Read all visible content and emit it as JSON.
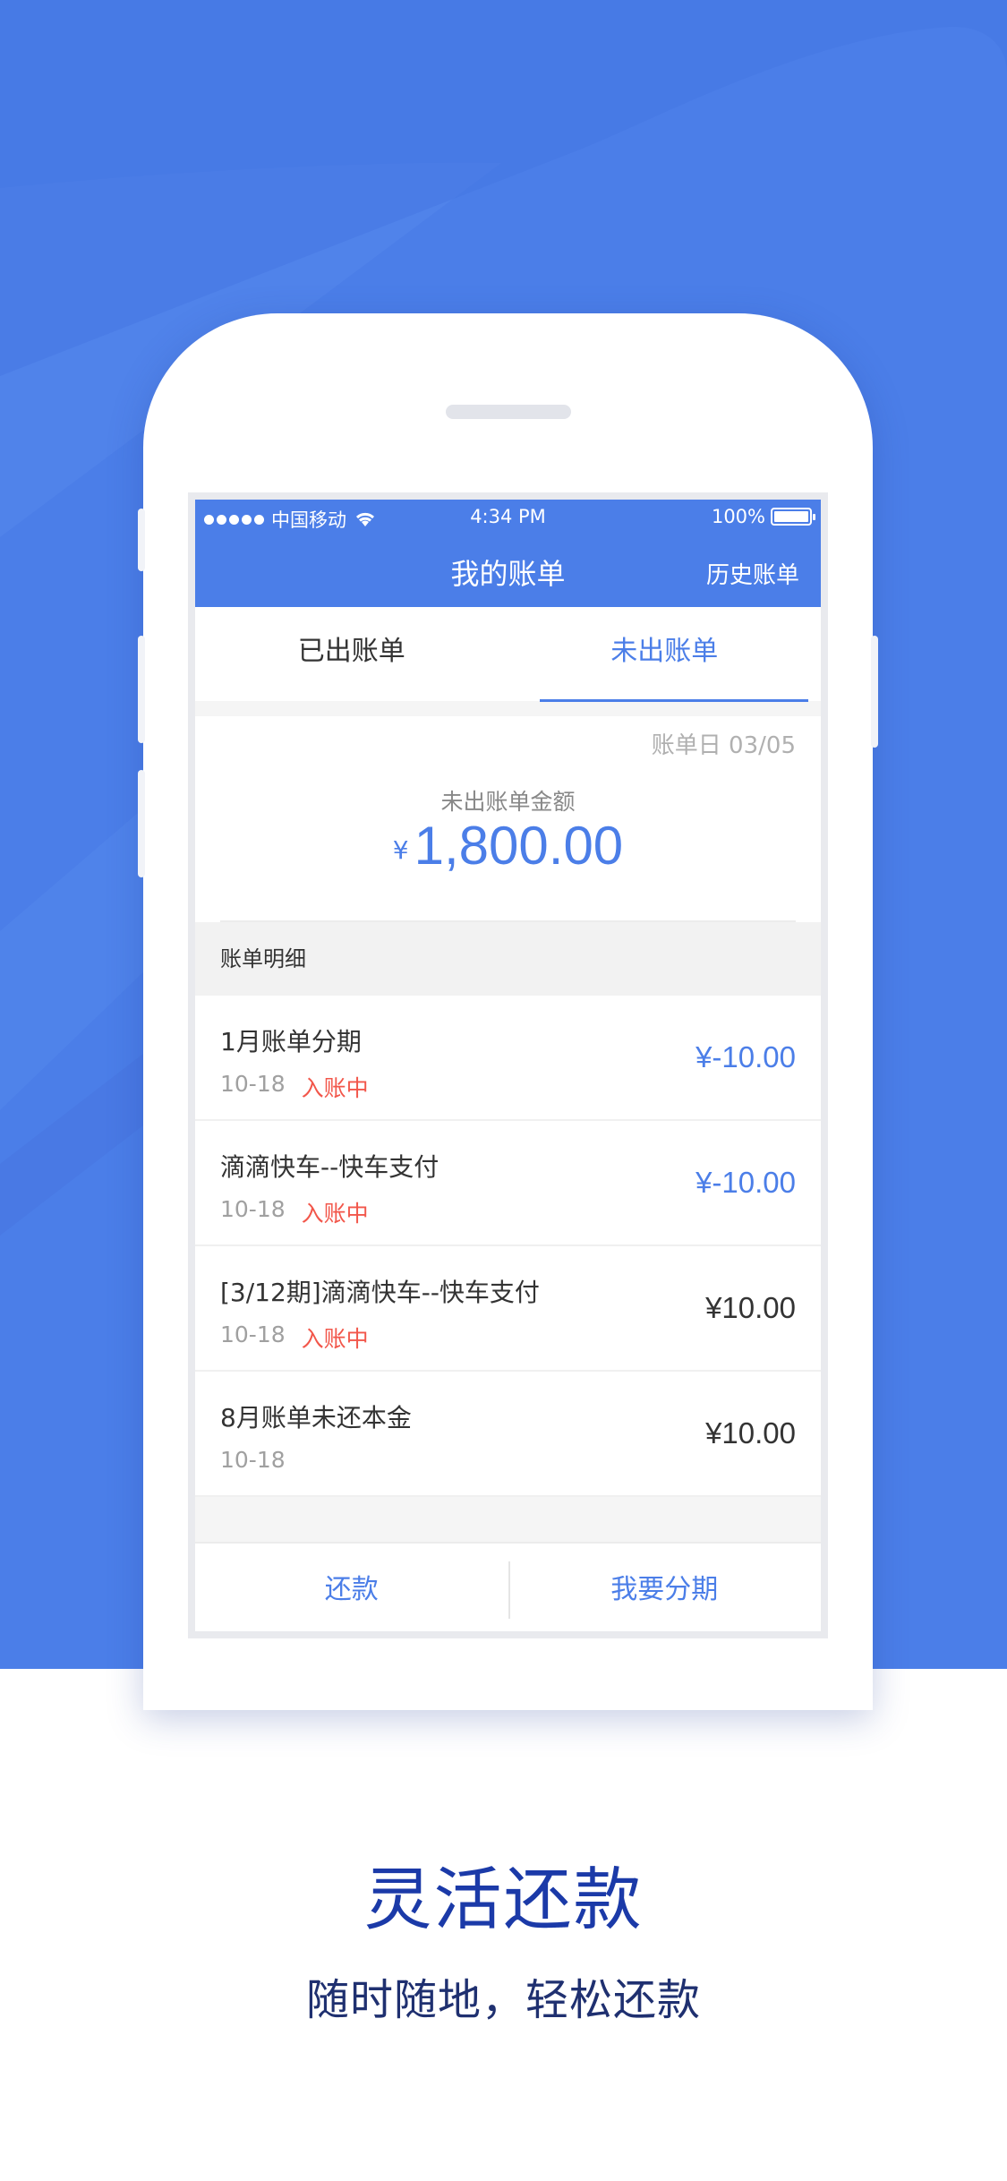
{
  "colors": {
    "brand_blue": "#4b7ee8",
    "status_red": "#f2574b",
    "caption_blue": "#1b3aa8",
    "caption_navy": "#1f3070"
  },
  "status_bar": {
    "carrier": "中国移动",
    "time": "4:34 PM",
    "battery": "100%",
    "wifi_icon": "wifi-icon",
    "battery_icon": "battery-icon"
  },
  "navbar": {
    "title": "我的账单",
    "history_label": "历史账单"
  },
  "tabs": [
    {
      "label": "已出账单",
      "selected": false
    },
    {
      "label": "未出账单",
      "selected": true
    }
  ],
  "summary": {
    "bill_date": "账单日 03/05",
    "label": "未出账单金额",
    "currency": "¥",
    "amount": "1,800.00"
  },
  "detail": {
    "header": "账单明细",
    "items": [
      {
        "title": "1月账单分期",
        "date": "10-18",
        "status": "入账中",
        "amount": "¥-10.00"
      },
      {
        "title": "滴滴快车--快车支付",
        "date": "10-18",
        "status": "入账中",
        "amount": "¥-10.00"
      },
      {
        "title": "[3/12期]滴滴快车--快车支付",
        "date": "10-18",
        "status": "入账中",
        "amount": "¥10.00"
      },
      {
        "title": "8月账单未还本金",
        "date": "10-18",
        "status": "",
        "amount": "¥10.00"
      }
    ]
  },
  "bottom_bar": {
    "repay_label": "还款",
    "installment_label": "我要分期"
  },
  "caption": {
    "title": "灵活还款",
    "subtitle": "随时随地，轻松还款"
  }
}
